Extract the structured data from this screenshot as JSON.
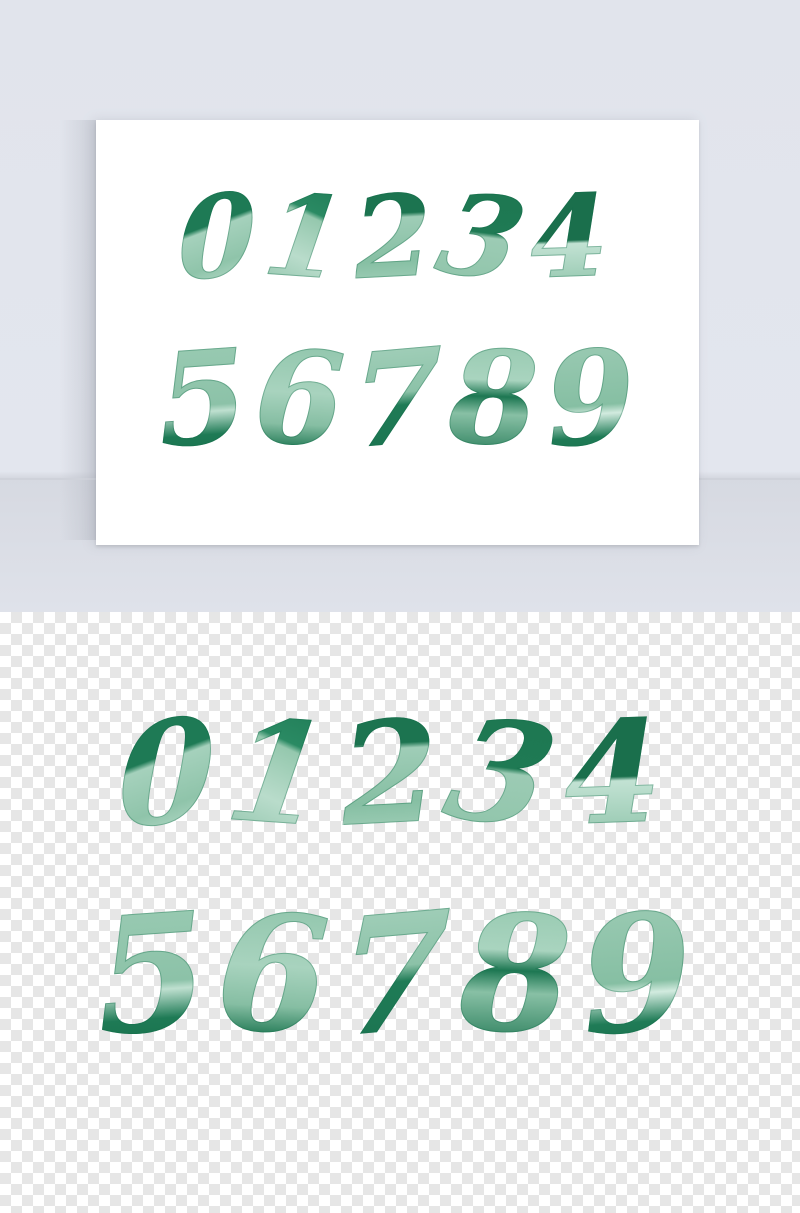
{
  "row_1": [
    "0",
    "1",
    "2",
    "3",
    "4"
  ],
  "row_2": [
    "5",
    "6",
    "7",
    "8",
    "9"
  ],
  "colors": {
    "dark_green": "#1e7a55",
    "light_green": "#8fc4aa",
    "pale_green": "#c9e6d8",
    "wall": "#e1e4ec",
    "checker": "#e6e6e6"
  }
}
